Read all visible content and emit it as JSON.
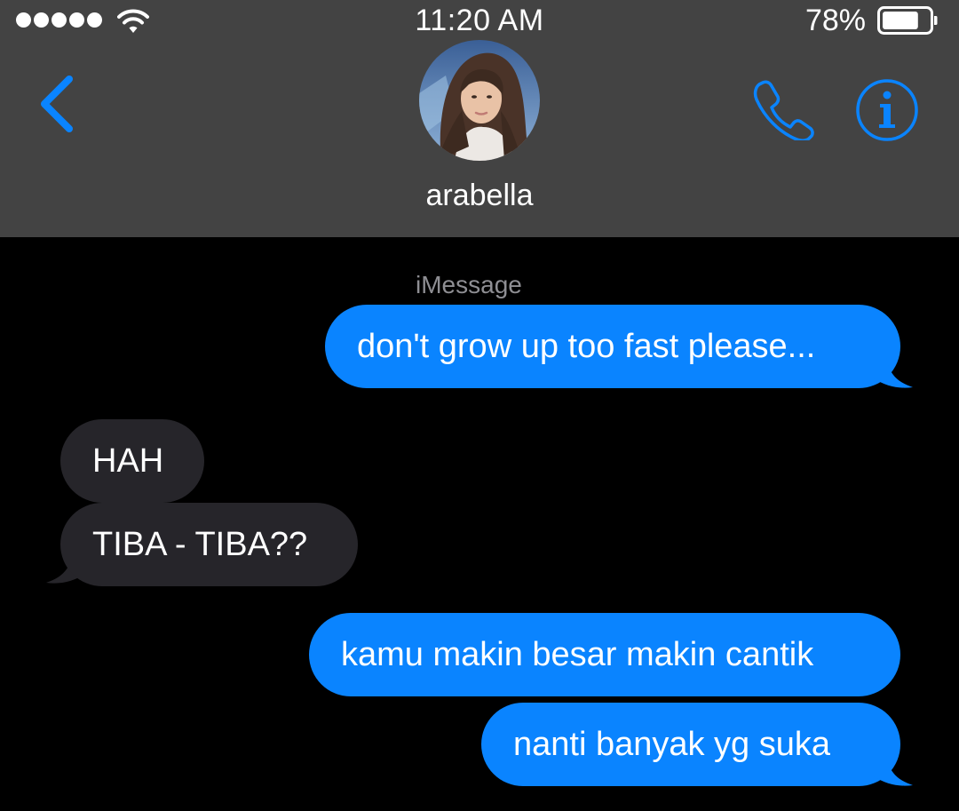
{
  "status_bar": {
    "time": "11:20 AM",
    "battery_percent": "78%",
    "battery_level": 0.78,
    "signal_bars": 5,
    "icons": [
      "signal-dots-icon",
      "wifi-icon",
      "battery-icon"
    ]
  },
  "nav": {
    "contact_name": "arabella",
    "icons": [
      "back-chevron-icon",
      "phone-icon",
      "info-icon"
    ],
    "accent_color": "#0a84ff"
  },
  "conversation": {
    "service_label": "iMessage",
    "messages": [
      {
        "direction": "sent",
        "text": "don't grow up too fast please..."
      },
      {
        "direction": "received",
        "text": "HAH"
      },
      {
        "direction": "received",
        "text": "TIBA - TIBA??"
      },
      {
        "direction": "sent",
        "text": "kamu makin besar makin cantik"
      },
      {
        "direction": "sent",
        "text": "nanti banyak yg suka"
      }
    ]
  },
  "colors": {
    "header_bg": "#434343",
    "background": "#000000",
    "sent_bubble": "#0a84ff",
    "received_bubble": "#26252a"
  }
}
